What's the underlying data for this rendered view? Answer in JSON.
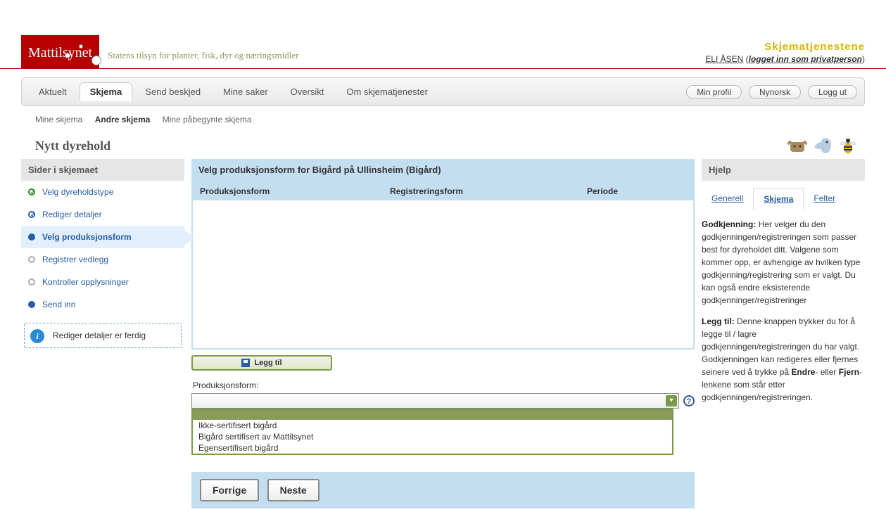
{
  "header": {
    "service_title": "Skjematjenestene",
    "user_name": "ELI ÅSEN",
    "login_status": "logget inn som privatperson",
    "logo_text": "Mattilsynet",
    "subtitle": "Statens tilsyn for planter, fisk, dyr og næringsmidler"
  },
  "tabs": {
    "items": [
      "Aktuelt",
      "Skjema",
      "Send beskjed",
      "Mine saker",
      "Oversikt",
      "Om skjematjenester"
    ],
    "active_index": 1,
    "pills": [
      "Min profil",
      "Nynorsk",
      "Logg ut"
    ]
  },
  "subtabs": {
    "items": [
      "Mine skjema",
      "Andre skjema",
      "Mine påbegynte skjema"
    ],
    "active_index": 1
  },
  "page_title": "Nytt dyrehold",
  "sidebar": {
    "header": "Sider i skjemaet",
    "steps": [
      {
        "label": "Velg dyreholdstype",
        "state": "done"
      },
      {
        "label": "Rediger detaljer",
        "state": "partial"
      },
      {
        "label": "Velg produksjonsform",
        "state": "current"
      },
      {
        "label": "Registrer vedlegg",
        "state": "pending"
      },
      {
        "label": "Kontroller opplysninger",
        "state": "pending"
      },
      {
        "label": "Send inn",
        "state": "send"
      }
    ],
    "info_message": "Rediger detaljer er ferdig"
  },
  "main": {
    "section_title": "Velg produksjonsform for Bigård på Ullinsheim (Bigård)",
    "table_headers": [
      "Produksjonsform",
      "Registreringsform",
      "Periode"
    ],
    "add_button": "Legg til",
    "field_label": "Produksjonsform:",
    "dropdown_options": [
      "Ikke-sertifisert bigård",
      "Bigård sertifisert av Mattilsynet",
      "Egensertifisert bigård"
    ],
    "nav_prev": "Forrige",
    "nav_next": "Neste"
  },
  "help": {
    "header": "Hjelp",
    "tabs": [
      "Generell",
      "Skjema",
      "Felter"
    ],
    "active_index": 1,
    "para1_label": "Godkjenning:",
    "para1_text": " Her velger du den godkjenningen/registreringen som passer best for dyreholdet ditt. Valgene som kommer opp, er avhengige av hvilken type godkjenning/registrering som er valgt. Du kan også endre eksisterende godkjenninger/registreringer",
    "para2_label": "Legg til:",
    "para2_text_a": " Denne knappen trykker du for å legge til / lagre godkjenningen/registreringen du har valgt. Godkjenningen kan redigeres eller fjernes seinere ved å trykke på ",
    "para2_b1": "Endre",
    "para2_mid": "- eller ",
    "para2_b2": "Fjern",
    "para2_text_b": "-lenkene som står etter godkjenningen/registreringen."
  }
}
